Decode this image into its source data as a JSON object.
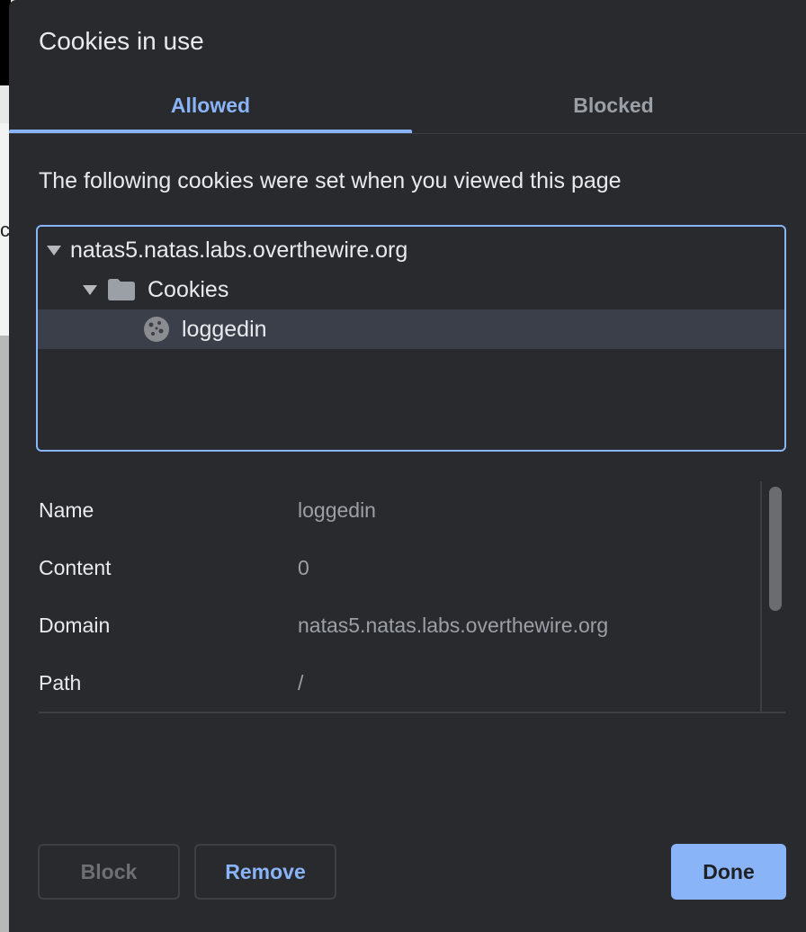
{
  "dialog": {
    "title": "Cookies in use",
    "tabs": [
      {
        "label": "Allowed",
        "active": true
      },
      {
        "label": "Blocked",
        "active": false
      }
    ],
    "subtitle": "The following cookies were set when you viewed this page",
    "tree": {
      "domain": "natas5.natas.labs.overthewire.org",
      "folder": "Cookies",
      "cookie": "loggedin",
      "selected": "loggedin"
    },
    "details": [
      {
        "label": "Name",
        "value": "loggedin"
      },
      {
        "label": "Content",
        "value": "0"
      },
      {
        "label": "Domain",
        "value": "natas5.natas.labs.overthewire.org"
      },
      {
        "label": "Path",
        "value": "/"
      }
    ],
    "buttons": {
      "block": "Block",
      "remove": "Remove",
      "done": "Done"
    }
  },
  "background": {
    "partial_char": "c"
  },
  "icons": {
    "expand": "triangle-down-icon",
    "folder": "folder-icon",
    "cookie": "cookie-icon"
  },
  "colors": {
    "dialog_bg": "#292a2d",
    "accent": "#8ab4f8",
    "text": "#e8eaed",
    "muted_text": "#9aa0a6",
    "selected_row": "#3b3f4a"
  }
}
